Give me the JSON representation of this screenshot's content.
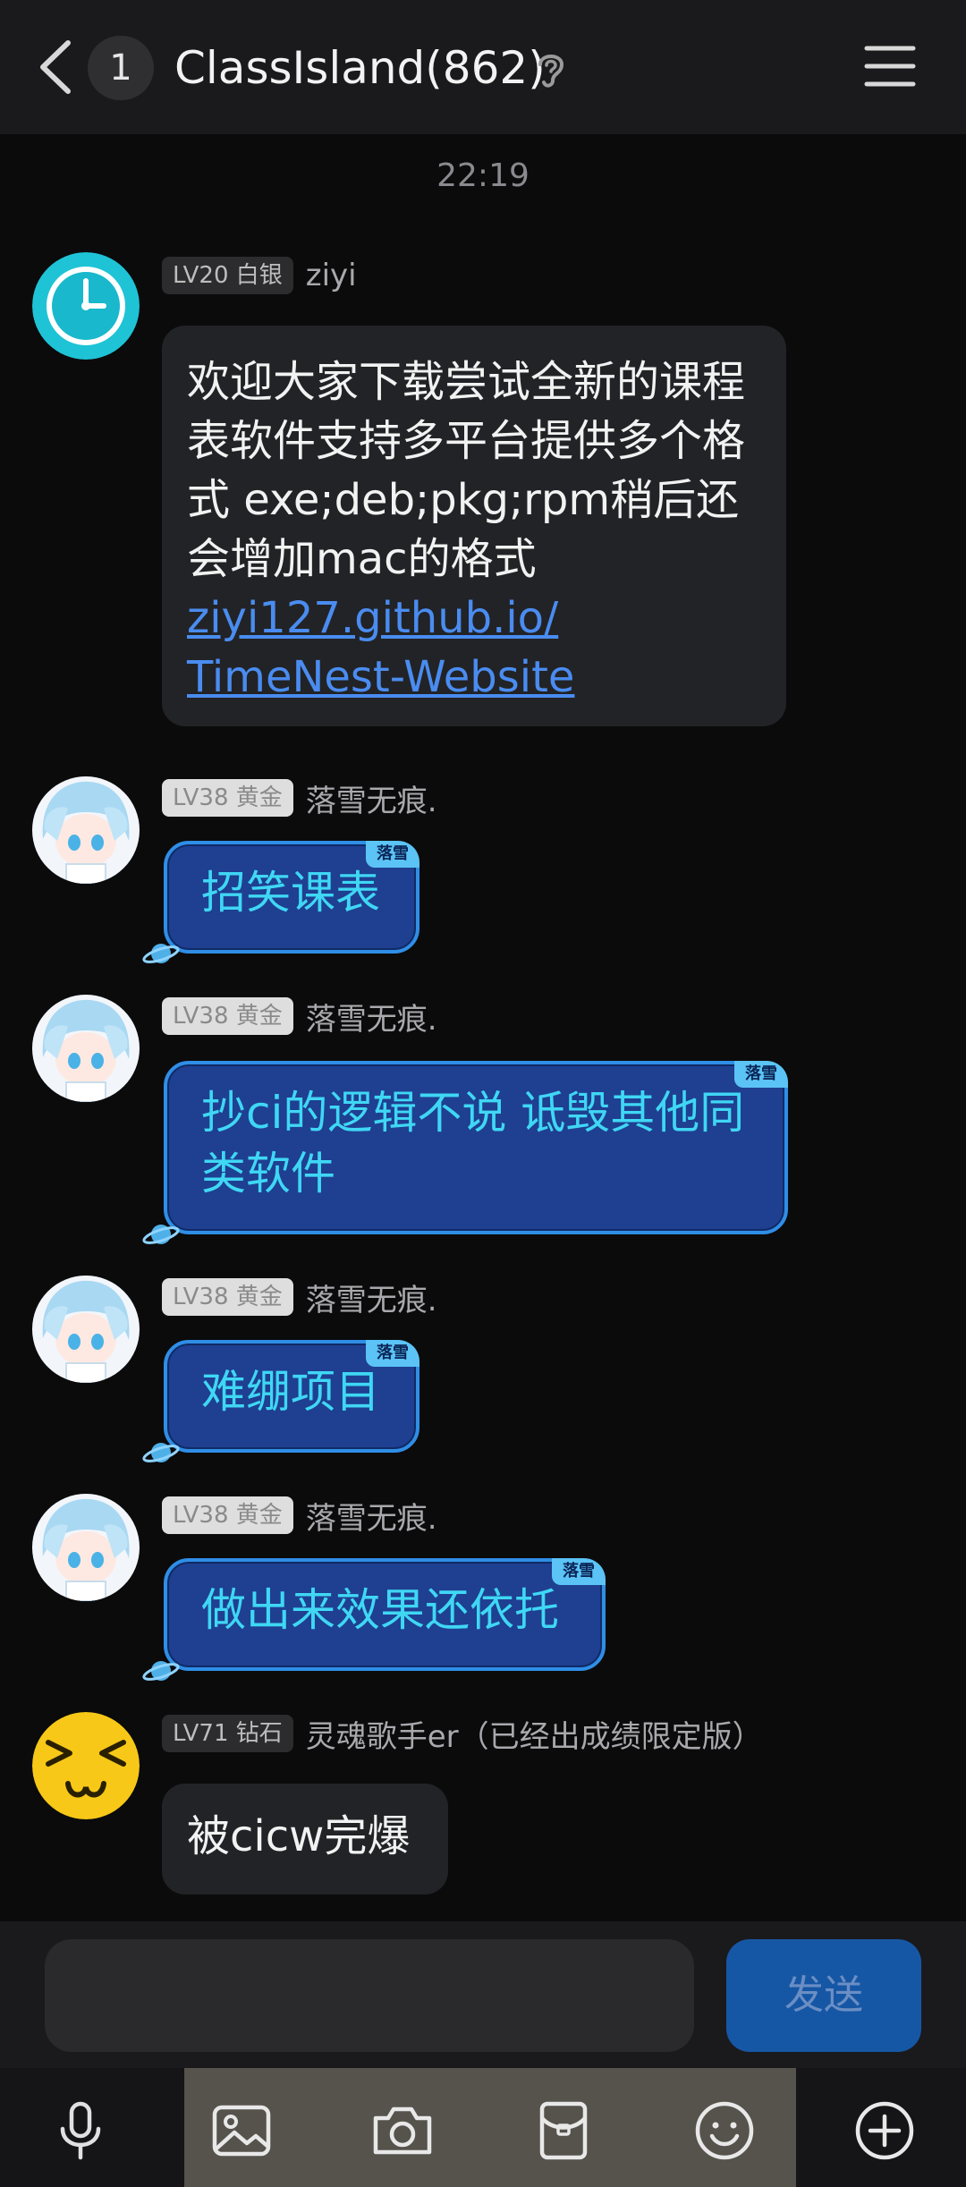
{
  "header": {
    "unread_count": "1",
    "title": "ClassIsland(862)"
  },
  "timestamp": "22:19",
  "messages": [
    {
      "level": "LV20 白银",
      "sender": "ziyi",
      "text": "欢迎大家下载尝试全新的课程表软件支持多平台提供多个格式 exe;deb;pkg;rpm稍后还会增加mac的格式",
      "link_line1": "ziyi127.github.io/",
      "link_line2": "TimeNest-Website"
    },
    {
      "level": "LV38 黄金",
      "sender": "落雪无痕.",
      "tag": "落雪",
      "text": "招笑课表"
    },
    {
      "level": "LV38 黄金",
      "sender": "落雪无痕.",
      "tag": "落雪",
      "text": "抄ci的逻辑不说  诋毁其他同类软件"
    },
    {
      "level": "LV38 黄金",
      "sender": "落雪无痕.",
      "tag": "落雪",
      "text": "难绷项目"
    },
    {
      "level": "LV38 黄金",
      "sender": "落雪无痕.",
      "tag": "落雪",
      "text": "做出来效果还依托"
    },
    {
      "level": "LV71 钻石",
      "sender": "灵魂歌手er（已经出成绩限定版）",
      "text": "被cicw完爆"
    }
  ],
  "input": {
    "placeholder": "",
    "send_label": "发送"
  },
  "toolbar_icons": [
    "microphone-icon",
    "image-icon",
    "camera-icon",
    "red-packet-icon",
    "emoji-icon",
    "plus-icon"
  ]
}
